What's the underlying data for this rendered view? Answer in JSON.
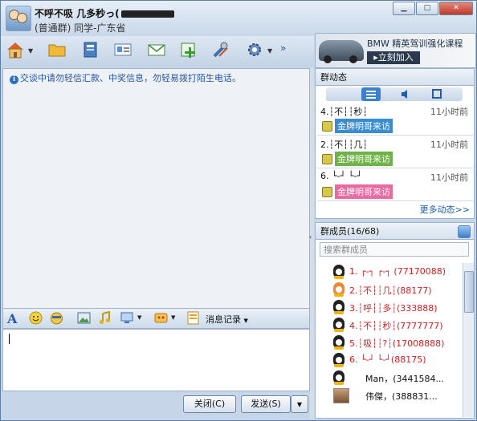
{
  "titlebar": {
    "name": "不呼不吸 几多秒っ(",
    "subtitle": "(普通群) 同学-广东省"
  },
  "ad": {
    "title": "BMW 精英驾训强化课程",
    "button": "▸立刻加入"
  },
  "chat": {
    "notice": "交谈中请勿轻信汇款、中奖信息，勿轻易拨打陌生电话。"
  },
  "input_toolbar": {
    "message_record_label": "消息记录"
  },
  "buttons": {
    "close_label": "关闭(C)",
    "send_label": "发送(S)"
  },
  "group_feed": {
    "header": "群动态",
    "items": [
      {
        "title": "4.┆不┆┆秒┆",
        "time": "11小时前",
        "tag": "金牌明哥来访",
        "tag_color": "#3b8bd0"
      },
      {
        "title": "2.┆不┆┆几┆",
        "time": "11小时前",
        "tag": "金牌明哥来访",
        "tag_color": "#6fb24a"
      },
      {
        "title": "6. └-┘ └-┘",
        "time": "11小时前",
        "tag": "金牌明哥来访",
        "tag_color": "#e86aa0"
      }
    ],
    "more_label": "更多动态>>"
  },
  "members": {
    "header": "群成员(16/68)",
    "search_placeholder": "搜索群成员",
    "items": [
      {
        "name": "1. ┌-┐ ┌-┐ (77170088)",
        "color": "#d02020"
      },
      {
        "name": "2.┆不┆┆几┆(88177)",
        "color": "#d02020"
      },
      {
        "name": "3.┆呼┆┆多┆(333888)",
        "color": "#d02020"
      },
      {
        "name": "4.┆不┆┆秒┆(7777777)",
        "color": "#d02020"
      },
      {
        "name": "5.┆吸┆┆?┆(17008888)",
        "color": "#d02020"
      },
      {
        "name": "6. └-┘ └-┘(88175)",
        "color": "#d02020"
      },
      {
        "name": "Man，(3441584...",
        "color": "#111111"
      },
      {
        "name": "伟傑，(388831...",
        "color": "#111111"
      }
    ]
  }
}
